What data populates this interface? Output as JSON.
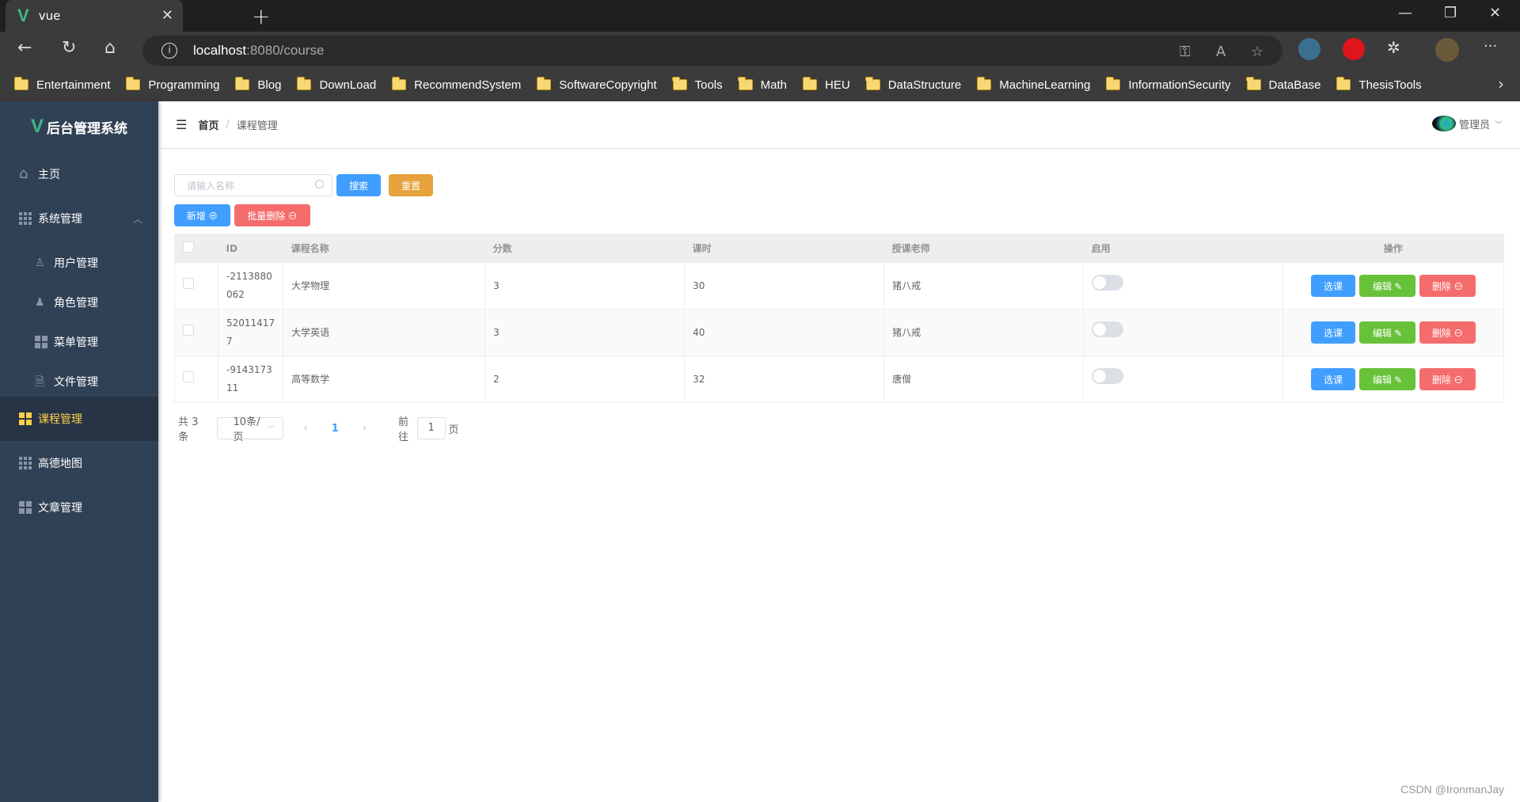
{
  "browser": {
    "tab_title": "vue",
    "url_host": "localhost",
    "url_rest": ":8080/course",
    "bookmarks": [
      "Entertainment",
      "Programming",
      "Blog",
      "DownLoad",
      "RecommendSystem",
      "SoftwareCopyright",
      "Tools",
      "Math",
      "HEU",
      "DataStructure",
      "MachineLearning",
      "InformationSecurity",
      "DataBase",
      "ThesisTools"
    ]
  },
  "sidebar": {
    "title": "后台管理系统",
    "items": [
      {
        "label": "主页",
        "icon": "home-icon"
      },
      {
        "label": "系统管理",
        "icon": "grid-icon",
        "expanded": true
      },
      {
        "label": "用户管理",
        "icon": "user-icon",
        "sub": true
      },
      {
        "label": "角色管理",
        "icon": "user-solid-icon",
        "sub": true
      },
      {
        "label": "菜单管理",
        "icon": "menu-icon",
        "sub": true
      },
      {
        "label": "文件管理",
        "icon": "document-icon",
        "sub": true
      },
      {
        "label": "课程管理",
        "icon": "menu-icon",
        "active": true
      },
      {
        "label": "高德地图",
        "icon": "grid-icon"
      },
      {
        "label": "文章管理",
        "icon": "menu-icon"
      }
    ]
  },
  "header": {
    "breadcrumb_home": "首页",
    "breadcrumb_sep": "/",
    "breadcrumb_current": "课程管理",
    "user_name": "管理员"
  },
  "toolbar": {
    "search_placeholder": "请输入名称",
    "search_label": "搜索",
    "reset_label": "重置",
    "add_label": "新增 ⊕",
    "batch_delete_label": "批量删除 ⊖"
  },
  "table": {
    "columns": [
      "",
      "ID",
      "课程名称",
      "分数",
      "课时",
      "授课老师",
      "启用",
      "操作"
    ],
    "rows": [
      {
        "id_line1": "-2113880",
        "id_line2": "062",
        "name": "大学物理",
        "score": "3",
        "hours": "30",
        "teacher": "猪八戒",
        "enabled": false
      },
      {
        "id_line1": "52011417",
        "id_line2": "7",
        "name": "大学英语",
        "score": "3",
        "hours": "40",
        "teacher": "猪八戒",
        "enabled": false
      },
      {
        "id_line1": "-9143173",
        "id_line2": "11",
        "name": "高等数学",
        "score": "2",
        "hours": "32",
        "teacher": "唐僧",
        "enabled": false
      }
    ],
    "actions": {
      "select": "选课",
      "edit": "编辑 ✎",
      "delete": "删除 ⊖"
    }
  },
  "pagination": {
    "total": "共 3 条",
    "page_size": "10条/页",
    "current_page": "1",
    "goto_label": "前往",
    "goto_value": "1",
    "page_suffix": "页"
  },
  "watermark": "CSDN @IronmanJay"
}
